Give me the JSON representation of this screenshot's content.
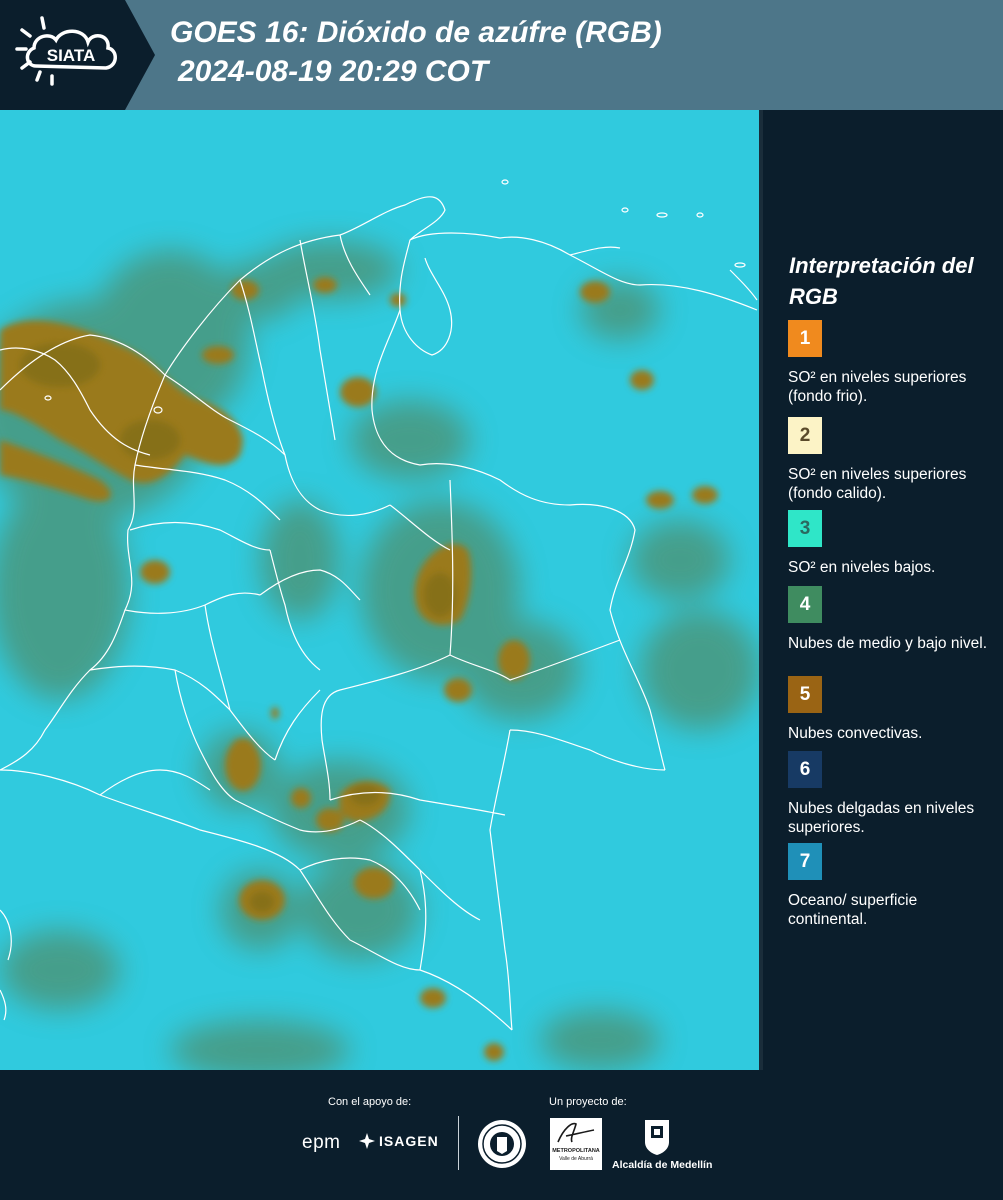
{
  "header": {
    "logo_text": "SIATA",
    "title_line1": "GOES 16: Dióxido de azúfre (RGB)",
    "title_line2": "2024-08-19 20:29 COT",
    "background_color": "#4d7689"
  },
  "legend": {
    "title": "Interpretación del RGB",
    "items": [
      {
        "number": "1",
        "color": "#f08a1e",
        "text_color": "#ffffff",
        "description": "SO² en niveles superiores (fondo frio)."
      },
      {
        "number": "2",
        "color": "#fcf3c6",
        "text_color": "#5a4a2a",
        "description": "SO² en niveles superiores (fondo calido)."
      },
      {
        "number": "3",
        "color": "#2fe6c8",
        "text_color": "#2b6a60",
        "description": "SO² en niveles bajos."
      },
      {
        "number": "4",
        "color": "#3f8c60",
        "text_color": "#ffffff",
        "description": "Nubes de medio y bajo nivel."
      },
      {
        "number": "5",
        "color": "#9a6414",
        "text_color": "#ffffff",
        "description": "Nubes convectivas."
      },
      {
        "number": "6",
        "color": "#173a64",
        "text_color": "#ffffff",
        "description": "Nubes delgadas en niveles superiores."
      },
      {
        "number": "7",
        "color": "#1f90b8",
        "text_color": "#ffffff",
        "description": "Oceano/ superficie continental."
      }
    ]
  },
  "footer": {
    "support_label": "Con el apoyo de:",
    "project_label": "Un proyecto de:",
    "epm_text": "epm",
    "isagen_text": "ISAGEN",
    "amva_text_line1": "METROPOLITANA",
    "amva_text_line2": "Valle de Aburrá",
    "alcaldia_text": "Alcaldía de Medellín"
  },
  "map": {
    "background_color": "#2cc6dc",
    "cloud_color": "#4e9070",
    "convective_color": "#9a7a1c",
    "border_color": "#ffffff"
  }
}
